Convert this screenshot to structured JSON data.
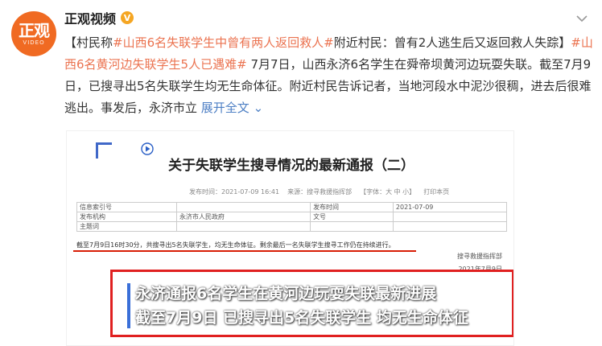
{
  "author": {
    "avatar_text": "正观",
    "avatar_subtext": "VIDEO",
    "name": "正观视频",
    "verified_mark": "V"
  },
  "post": {
    "segments": [
      {
        "text": "【村民称",
        "type": "plain"
      },
      {
        "text": "#山西6名失联学生中曾有两人返回救人#",
        "type": "tag"
      },
      {
        "text": "附近村民：曾有2人逃生后又返回救人失踪】",
        "type": "plain"
      },
      {
        "text": "#山西6名黄河边失联学生5人已遇难#",
        "type": "tag"
      },
      {
        "text": " 7月7日，山西永济6名学生在舜帝坝黄河边玩耍失联。截至7月9日，已搜寻出5名失联学生均无生命体征。附近村民告诉记者，当地河段水中泥沙很稠，进去后很难逃出。事发后，永济市立 ",
        "type": "plain"
      },
      {
        "text": "展开全文",
        "type": "more"
      }
    ],
    "more_icon": "chevron-down-icon"
  },
  "embed": {
    "doc_title": "关于失联学生搜寻情况的最新通报（二）",
    "meta": {
      "time": "发布时间：2021-07-09 16:41",
      "source": "来源：搜寻救援指挥部",
      "font": "【字体：大 中 小】",
      "print": "打印本页"
    },
    "table": {
      "rows": [
        [
          "信息索引号",
          "",
          "发布时间",
          "2021-07-09"
        ],
        [
          "发布机构",
          "永济市人民政府",
          "文号",
          ""
        ],
        [
          "主题词",
          "",
          "",
          ""
        ]
      ]
    },
    "notice": "截至7月9日16时30分，共搜寻出5名失联学生，均无生命体征。剩余最后一名失联学生搜寻工作仍在持续进行。",
    "signature": "搜寻救援指挥部",
    "signature_date": "2021年7月9日",
    "caption_line1": "永济通报6名学生在黄河边玩耍失联最新进展",
    "caption_line2": "截至7月9日 已搜寻出5名失联学生 均无生命体征"
  }
}
